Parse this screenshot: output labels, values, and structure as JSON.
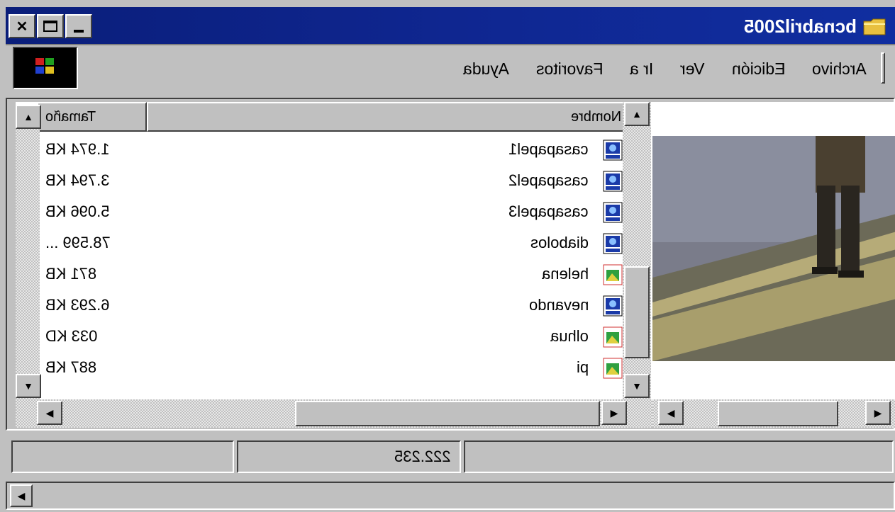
{
  "window": {
    "title": "bcnabril2005",
    "icon": "folder-icon",
    "caption_buttons": [
      "minimize",
      "maximize",
      "close"
    ]
  },
  "menu": {
    "items": [
      {
        "label": "Archivo"
      },
      {
        "label": "Edición"
      },
      {
        "label": "Ver"
      },
      {
        "label": "Ir a"
      },
      {
        "label": "Favoritos"
      },
      {
        "label": "Ayuda"
      }
    ]
  },
  "list": {
    "columns": {
      "name": "Nombre",
      "size": "Tamaño"
    },
    "rows": [
      {
        "name": "casapapel1",
        "size": "1.974 KB",
        "type": "video"
      },
      {
        "name": "casapapel2",
        "size": "3.794 KB",
        "type": "video"
      },
      {
        "name": "casapapel3",
        "size": "5.096 KB",
        "type": "video"
      },
      {
        "name": "diabolos",
        "size": "78.599 ...",
        "type": "video"
      },
      {
        "name": "helena",
        "size": "871 KB",
        "type": "image"
      },
      {
        "name": "nevando",
        "size": "6.293 KB",
        "type": "video"
      },
      {
        "name": "olhua",
        "size": "033 KD",
        "type": "image"
      },
      {
        "name": "pi",
        "size": "887 KB",
        "type": "image"
      }
    ]
  },
  "status": {
    "total": "222.235"
  },
  "colors": {
    "titlebar": "#0a1e7a",
    "face": "#c0c0c0",
    "window": "#ffffff"
  }
}
